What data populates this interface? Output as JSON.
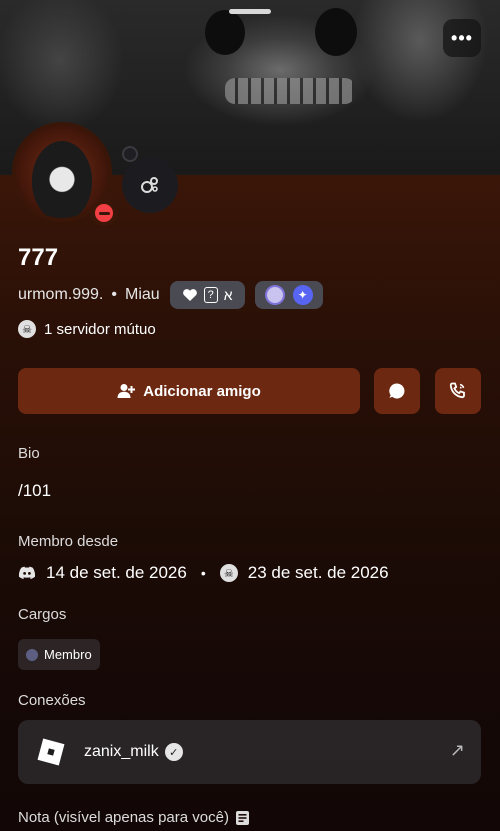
{
  "header": {
    "more_label": "•••"
  },
  "profile": {
    "display_name": "777",
    "username": "urmom.999.",
    "separator": "•",
    "pronouns": "Miau",
    "tag_chip_text": "א",
    "tag_chip_box": "?",
    "mutual_servers": "1 servidor mútuo"
  },
  "actions": {
    "add_friend_label": "Adicionar amigo"
  },
  "bio": {
    "label": "Bio",
    "text": "/101"
  },
  "member_since": {
    "label": "Membro desde",
    "discord_date": "14 de set. de 2026",
    "dot": "•",
    "server_date": "23 de set. de 2026"
  },
  "roles": {
    "label": "Cargos",
    "items": [
      {
        "name": "Membro",
        "color": "#5d5f82"
      }
    ]
  },
  "connections": {
    "label": "Conexões",
    "items": [
      {
        "service_icon": "roblox-icon",
        "account": "zanix_milk",
        "verified": true
      }
    ]
  },
  "note": {
    "label": "Nota (visível apenas para você)"
  },
  "colors": {
    "accent_button": "#6c2811",
    "status_dnd": "#f23f43",
    "background_top": "#3a1608",
    "background_bottom": "#120706"
  }
}
